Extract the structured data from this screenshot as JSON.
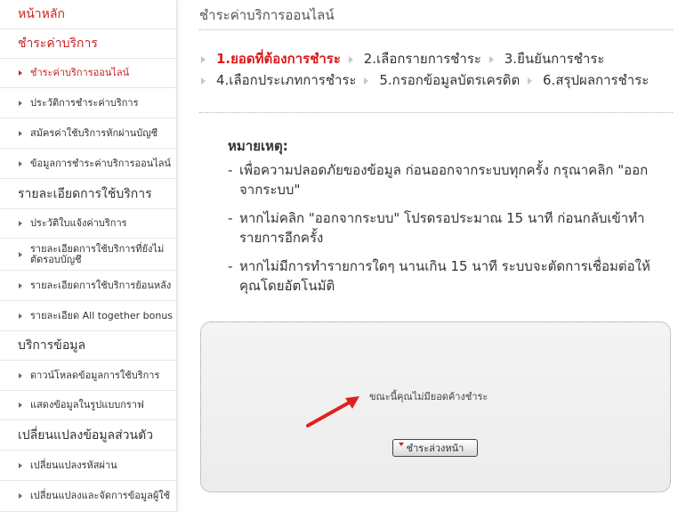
{
  "sidebar": {
    "items": [
      {
        "label": "หน้าหลัก",
        "kind": "head",
        "red": true
      },
      {
        "label": "ชำระค่าบริการ",
        "kind": "head",
        "red": true
      },
      {
        "label": "ชำระค่าบริการออนไลน์",
        "kind": "item",
        "active": true
      },
      {
        "label": "ประวัติการชำระค่าบริการ",
        "kind": "item"
      },
      {
        "label": "สมัครค่าใช้บริการหักผ่านบัญชี",
        "kind": "item"
      },
      {
        "label": "ข้อมูลการชำระค่าบริการออนไลน์",
        "kind": "item"
      },
      {
        "label": "รายละเอียดการใช้บริการ",
        "kind": "head"
      },
      {
        "label": "ประวัติใบแจ้งค่าบริการ",
        "kind": "item"
      },
      {
        "label": "รายละเอียดการใช้บริการที่ยังไม่ตัดรอบบัญชี",
        "kind": "item"
      },
      {
        "label": "รายละเอียดการใช้บริการย้อนหลัง",
        "kind": "item"
      },
      {
        "label": "รายละเอียด All together bonus",
        "kind": "item"
      },
      {
        "label": "บริการข้อมูล",
        "kind": "head"
      },
      {
        "label": "ดาวน์โหลดข้อมูลการใช้บริการ",
        "kind": "item"
      },
      {
        "label": "แสดงข้อมูลในรูปแบบกราฟ",
        "kind": "item"
      },
      {
        "label": "เปลี่ยนแปลงข้อมูลส่วนตัว",
        "kind": "head"
      },
      {
        "label": "เปลี่ยนแปลงรหัสผ่าน",
        "kind": "item"
      },
      {
        "label": "เปลี่ยนแปลงและจัดการข้อมูลผู้ใช้",
        "kind": "item"
      }
    ]
  },
  "main": {
    "title": "ชำระค่าบริการออนไลน์",
    "steps": [
      {
        "label": "1.ยอดที่ต้องการชำระ",
        "active": true
      },
      {
        "label": "2.เลือกรายการชำระ"
      },
      {
        "label": "3.ยืนยันการชำระ"
      },
      {
        "label": "4.เลือกประเภทการชำระ"
      },
      {
        "label": "5.กรอกข้อมูลบัตรเครดิต"
      },
      {
        "label": "6.สรุปผลการชำระ"
      }
    ],
    "note_title": "หมายเหตุ:",
    "notes": [
      "เพื่อความปลอดภัยของข้อมูล ก่อนออกจากระบบทุกครั้ง กรุณาคลิก \"ออกจากระบบ\"",
      "หากไม่คลิก \"ออกจากระบบ\" โปรดรอประมาณ 15 นาที ก่อนกลับเข้าทำรายการอีกครั้ง",
      "หากไม่มีการทำรายการใดๆ นานเกิน 15 นาที ระบบจะตัดการเชื่อมต่อให้คุณโดยอัตโนมัติ"
    ],
    "status_message": "ขณะนี้คุณไม่มียอดค้างชำระ",
    "back_button": "ชำระล่วงหน้า"
  },
  "colors": {
    "accent_red": "#dd1a1a",
    "arrow_red": "#e02020"
  }
}
